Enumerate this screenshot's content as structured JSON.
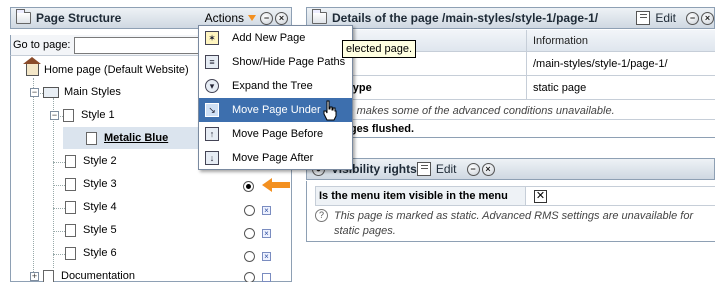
{
  "left_panel": {
    "title": "Page Structure",
    "actions_label": "Actions",
    "goto_label": "Go to page:",
    "goto_value": "",
    "tree": [
      {
        "label": "Home page (Default Website)"
      },
      {
        "label": "Main Styles"
      },
      {
        "label": "Style 1"
      },
      {
        "label": "Metalic Blue"
      },
      {
        "label": "Style 2"
      },
      {
        "label": "Style 3"
      },
      {
        "label": "Style 4"
      },
      {
        "label": "Style 5"
      },
      {
        "label": "Style 6"
      },
      {
        "label": "Documentation"
      }
    ]
  },
  "actions_menu": {
    "items": [
      {
        "label": "Add New Page",
        "icon": "star-page-icon"
      },
      {
        "label": "Show/Hide Page Paths",
        "icon": "list-icon"
      },
      {
        "label": "Expand the Tree",
        "icon": "expand-icon"
      },
      {
        "label": "Move Page Under",
        "icon": "move-under-icon"
      },
      {
        "label": "Move Page Before",
        "icon": "move-before-icon"
      },
      {
        "label": "Move Page After",
        "icon": "move-after-icon"
      }
    ],
    "highlighted_index": 3
  },
  "tooltip": "elected page.",
  "details_panel": {
    "title": "Details of the page /main-styles/style-1/page-1/",
    "edit_label": "Edit",
    "col_header": "Information",
    "rows": [
      {
        "key": "L",
        "value": "/main-styles/style-1/page-1/"
      },
      {
        "key": "erving type",
        "value": "static page"
      }
    ],
    "note": "tic page makes some of the advanced conditions unavailable.",
    "flushed": "atic pages flushed."
  },
  "visibility_panel": {
    "title": "Visibility rights",
    "edit_label": "Edit",
    "question": "Is the menu item visible in the menu",
    "check_mark": "✕",
    "note": "This page is marked as static. Advanced RMS settings are unavailable for static pages."
  },
  "colors": {
    "accent": "#f39020",
    "highlight": "#3d6fae",
    "tooltip_bg": "#ffffe1"
  }
}
